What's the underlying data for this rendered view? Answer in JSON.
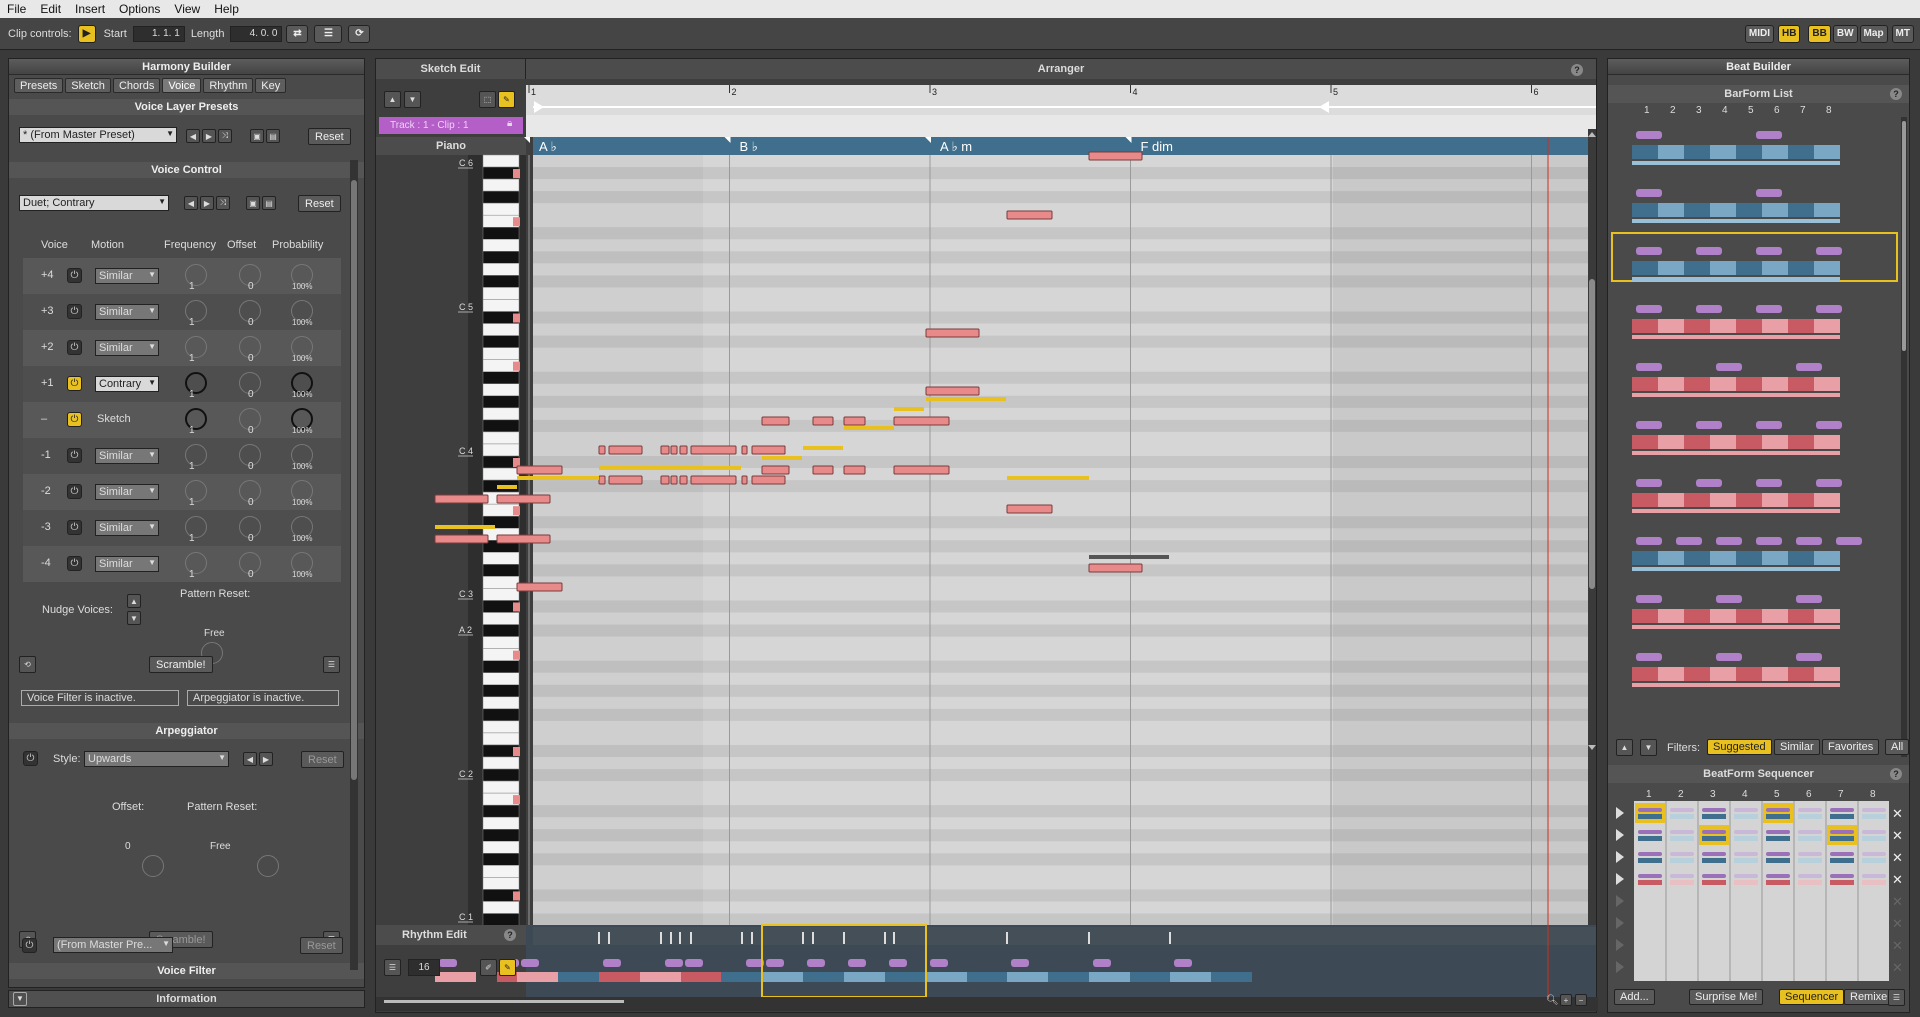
{
  "menu": [
    "File",
    "Edit",
    "Insert",
    "Options",
    "View",
    "Help"
  ],
  "toolbar": {
    "clip_controls": "Clip controls:",
    "start_label": "Start",
    "start_value": "1. 1. 1",
    "length_label": "Length",
    "length_value": "4. 0. 0",
    "right_buttons": [
      "MIDI",
      "HB",
      "BB",
      "BW",
      "Map",
      "MT"
    ]
  },
  "harmony": {
    "title": "Harmony Builder",
    "tabs": [
      "Presets",
      "Sketch",
      "Chords",
      "Voice",
      "Rhythm",
      "Key"
    ],
    "active_tab": "Voice",
    "voice_layer_presets": "Voice Layer Presets",
    "preset_value": "* (From Master Preset)",
    "reset": "Reset",
    "voice_control": "Voice Control",
    "voice_control_value": "Duet; Contrary",
    "headers": [
      "Voice",
      "Motion",
      "Frequency",
      "Offset",
      "Probability"
    ],
    "rows": [
      {
        "voice": "+4",
        "motion": "Similar",
        "freq": "1",
        "offset": "0",
        "prob": "100%",
        "on": false
      },
      {
        "voice": "+3",
        "motion": "Similar",
        "freq": "1",
        "offset": "0",
        "prob": "100%",
        "on": false
      },
      {
        "voice": "+2",
        "motion": "Similar",
        "freq": "1",
        "offset": "0",
        "prob": "100%",
        "on": false
      },
      {
        "voice": "+1",
        "motion": "Contrary",
        "freq": "1",
        "offset": "0",
        "prob": "100%",
        "on": true
      },
      {
        "voice": "–",
        "motion": "Sketch",
        "freq": "1",
        "offset": "0",
        "prob": "100%",
        "on": true
      },
      {
        "voice": "-1",
        "motion": "Similar",
        "freq": "1",
        "offset": "0",
        "prob": "100%",
        "on": false
      },
      {
        "voice": "-2",
        "motion": "Similar",
        "freq": "1",
        "offset": "0",
        "prob": "100%",
        "on": false
      },
      {
        "voice": "-3",
        "motion": "Similar",
        "freq": "1",
        "offset": "0",
        "prob": "100%",
        "on": false
      },
      {
        "voice": "-4",
        "motion": "Similar",
        "freq": "1",
        "offset": "0",
        "prob": "100%",
        "on": false
      }
    ],
    "nudge_voices": "Nudge Voices:",
    "pattern_reset": "Pattern Reset:",
    "free": "Free",
    "scramble": "Scramble!",
    "voice_filter_status": "Voice Filter is inactive.",
    "arp_status": "Arpeggiator is inactive.",
    "arpeggiator": "Arpeggiator",
    "style_label": "Style:",
    "style_value": "Upwards",
    "offset_label": "Offset:",
    "offset_value": "0",
    "voice_filter": "Voice Filter",
    "vf_value": "(From Master Pre...",
    "information": "Information"
  },
  "arranger": {
    "sketch_edit": "Sketch Edit",
    "title": "Arranger",
    "help": "?",
    "track_label": "Track : 1 - Clip : 1",
    "instrument": "Piano",
    "bars": [
      "1",
      "2",
      "3",
      "4",
      "5",
      "6"
    ],
    "chords": [
      "A ♭",
      "B ♭",
      "A ♭ m",
      "F dim"
    ],
    "octaves": [
      "C 6",
      "C 5",
      "C 4",
      "C 3",
      "A 2",
      "C 2",
      "C 1"
    ],
    "rhythm_edit": "Rhythm Edit",
    "grid_value": "16"
  },
  "beat": {
    "title": "Beat Builder",
    "barform_list": "BarForm List",
    "cols": [
      "1",
      "2",
      "3",
      "4",
      "5",
      "6",
      "7",
      "8"
    ],
    "filters_label": "Filters:",
    "filters": [
      "Suggested",
      "Similar",
      "Favorites",
      "All"
    ],
    "sequencer_title": "BeatForm Sequencer",
    "seq_cols": [
      "1",
      "2",
      "3",
      "4",
      "5",
      "6",
      "7",
      "8"
    ],
    "bottom": [
      "Add...",
      "Surprise Me!",
      "Sequencer",
      "Remixer"
    ]
  },
  "colors": {
    "accent": "#e8c020",
    "note": "#e88a8a",
    "chord_bar": "#3f6f8c",
    "track": "#b45fc8"
  }
}
